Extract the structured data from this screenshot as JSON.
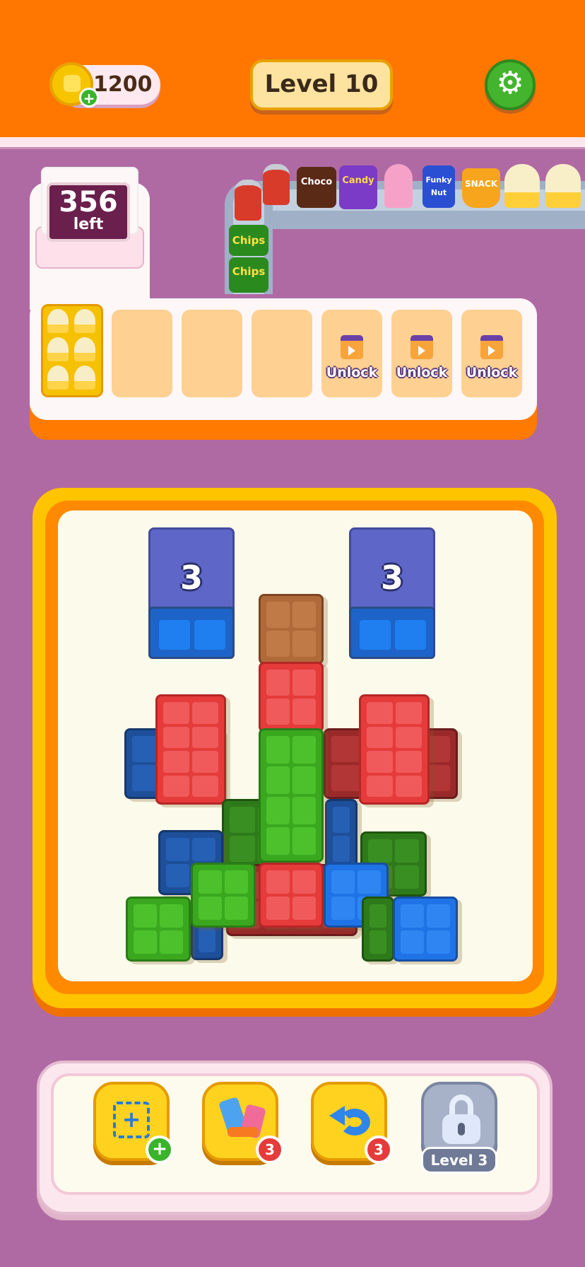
{
  "header": {
    "coins": "1200",
    "coin_add_symbol": "+",
    "level_label": "Level 10",
    "settings_icon": "gear-icon"
  },
  "counter": {
    "remaining": "356",
    "remaining_label": "left"
  },
  "conveyor": {
    "items": [
      {
        "name": "soda-can-icon",
        "label": ""
      },
      {
        "name": "choco-bag",
        "label": "Choco"
      },
      {
        "name": "candy-bag",
        "label": "Candy"
      },
      {
        "name": "ice-cream-icon",
        "label": ""
      },
      {
        "name": "funky-nut-bag",
        "label": "Funky Nut"
      },
      {
        "name": "snack-cup",
        "label": "SNACK"
      },
      {
        "name": "popcorn-icon",
        "label": ""
      },
      {
        "name": "popcorn-icon",
        "label": ""
      }
    ],
    "queue": [
      {
        "name": "soda-can-icon",
        "label": ""
      },
      {
        "name": "chips-bag",
        "label": "Chips"
      },
      {
        "name": "chips-bag",
        "label": "Chips"
      }
    ]
  },
  "slots": {
    "unlock_label": "Unlock"
  },
  "board": {
    "storage_counts": [
      "3",
      "3"
    ]
  },
  "toolbar": {
    "shuffle_count": "3",
    "undo_count": "3",
    "locked_label": "Level 3",
    "add_symbol": "+"
  },
  "colors": {
    "header": "#ff7700",
    "background": "#b06aa3",
    "red": "#e63b3b",
    "green": "#3aa81f",
    "blue": "#1f73e6",
    "dark_blue": "#1e4f9a",
    "dark_red": "#9a2a2a",
    "dark_green": "#2e7a1a",
    "brown": "#b06a3a"
  }
}
